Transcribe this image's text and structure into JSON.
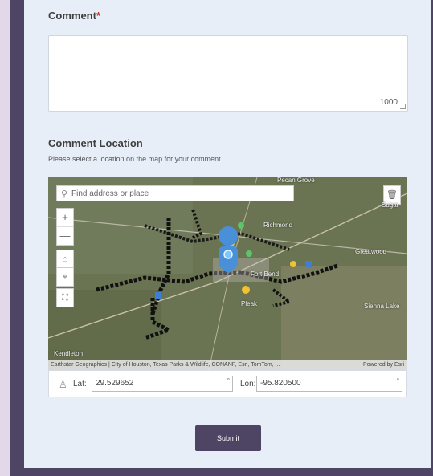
{
  "form": {
    "comment_label": "Comment",
    "required_marker": "*",
    "comment_value": "",
    "char_count": "1000",
    "location_label": "Comment Location",
    "location_hint": "Please select a location on the map for your comment.",
    "submit_label": "Submit"
  },
  "map": {
    "search_placeholder": "Find address or place",
    "zoom_in": "+",
    "zoom_out": "—",
    "place_labels": [
      "Pecan Grove",
      "Sugar",
      "Richmond",
      "Greatwood",
      "Fort Bend",
      "Pleak",
      "Sienna Lake",
      "Kendleton"
    ],
    "attribution": "Earthstar Geographics | City of Houston, Texas Parks & Wildlife, CONANP, Esri, TomTom, ...",
    "powered_by": "Powered by Esri",
    "accent": "#4a90d9"
  },
  "coords": {
    "lat_label": "Lat:",
    "lat_value": "29.529652",
    "lon_label": "Lon:",
    "lon_value": "-95.820500",
    "degree_symbol": "°"
  }
}
